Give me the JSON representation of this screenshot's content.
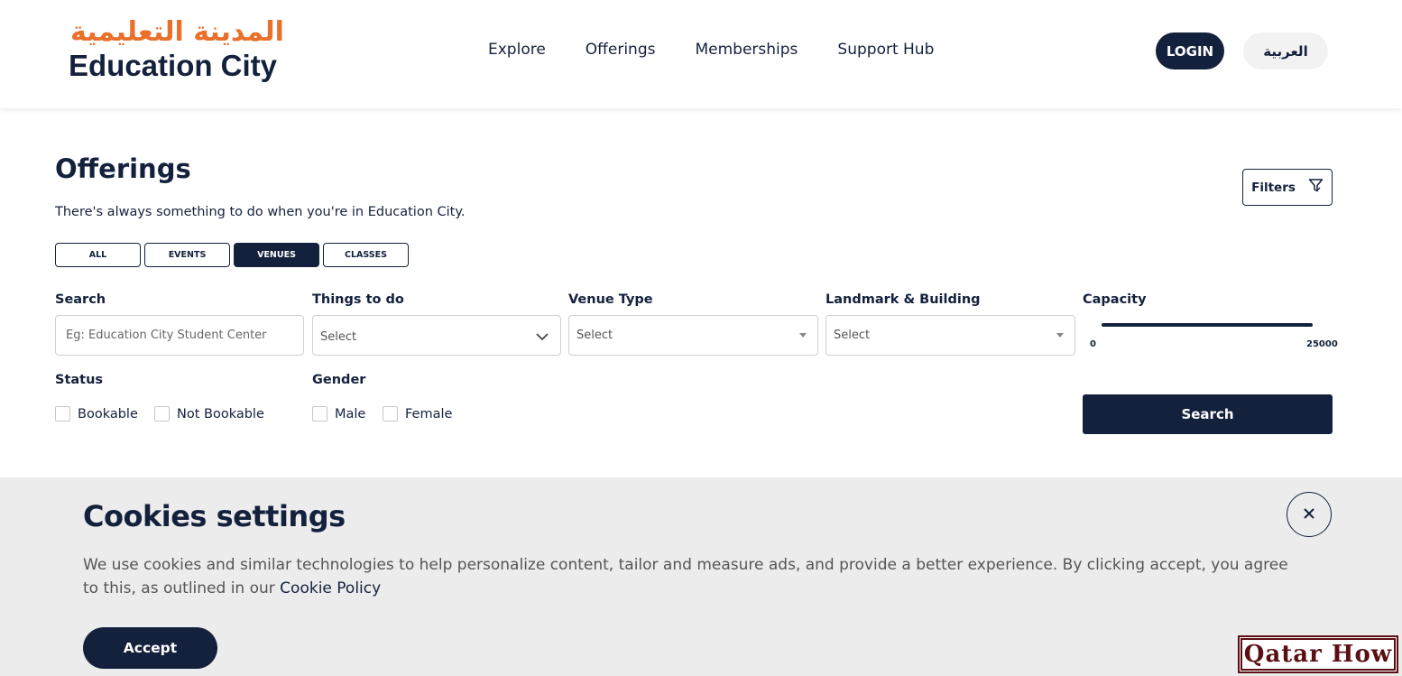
{
  "header": {
    "logo_ar": "المدينة التعليمية",
    "logo_en": "Education City",
    "nav": [
      "Explore",
      "Offerings",
      "Memberships",
      "Support Hub"
    ],
    "login_label": "LOGIN",
    "lang_label": "العربية"
  },
  "page": {
    "title": "Offerings",
    "subtitle": "There's always something to do when you're in Education City.",
    "filters_label": "Filters",
    "tabs": [
      {
        "label": "ALL",
        "active": false
      },
      {
        "label": "EVENTS",
        "active": false
      },
      {
        "label": "VENUES",
        "active": true
      },
      {
        "label": "CLASSES",
        "active": false
      }
    ]
  },
  "form": {
    "search_label": "Search",
    "search_placeholder": "Eg: Education City Student Center",
    "things_label": "Things to do",
    "things_value": "Select",
    "venue_label": "Venue Type",
    "venue_value": "Select",
    "landmark_label": "Landmark & Building",
    "landmark_value": "Select",
    "capacity_label": "Capacity",
    "capacity_min": "0",
    "capacity_max": "25000",
    "status_label": "Status",
    "status_options": [
      "Bookable",
      "Not Bookable"
    ],
    "gender_label": "Gender",
    "gender_options": [
      "Male",
      "Female"
    ],
    "search_button": "Search"
  },
  "cookies": {
    "title": "Cookies settings",
    "text": "We use cookies and similar technologies to help personalize content, tailor and measure ads, and provide a better experience. By clicking accept, you agree to this, as outlined in our ",
    "link": "Cookie Policy",
    "accept_label": "Accept"
  },
  "watermark": "Qatar How",
  "colors": {
    "primary": "#14213d",
    "logo_orange": "#e8702a",
    "cookie_bg": "#ececec"
  }
}
